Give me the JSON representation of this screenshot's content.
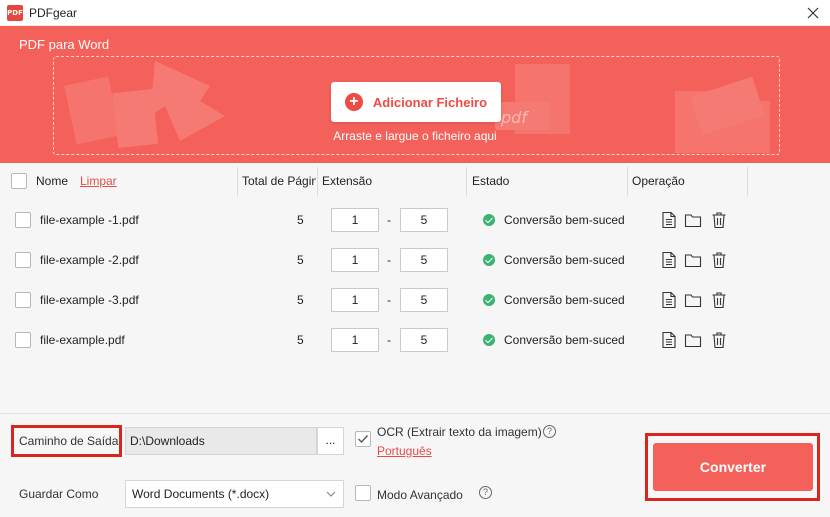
{
  "window": {
    "title": "PDFgear",
    "logo_text": "PDF"
  },
  "hero": {
    "title": "PDF para Word",
    "add_button_label": "Adicionar Ficheiro",
    "drop_hint": "Arraste e largue o ficheiro aqui",
    "deco_text": "pdf"
  },
  "table": {
    "headers": {
      "name": "Nome",
      "clear": "Limpar",
      "pages": "Total de Páginas",
      "range": "Extensão",
      "status": "Estado",
      "operation": "Operação"
    },
    "rows": [
      {
        "name": "file-example -1.pdf",
        "pages": "5",
        "from": "1",
        "to": "5",
        "status": "Conversão bem-sucedida"
      },
      {
        "name": "file-example -2.pdf",
        "pages": "5",
        "from": "1",
        "to": "5",
        "status": "Conversão bem-sucedida"
      },
      {
        "name": "file-example -3.pdf",
        "pages": "5",
        "from": "1",
        "to": "5",
        "status": "Conversão bem-sucedida"
      },
      {
        "name": "file-example.pdf",
        "pages": "5",
        "from": "1",
        "to": "5",
        "status": "Conversão bem-sucedida"
      }
    ],
    "range_separator": "-"
  },
  "bottom": {
    "output_path_label": "Caminho de Saída",
    "output_path_value": "D:\\Downloads",
    "browse_label": "...",
    "ocr_label": "OCR (Extrair texto da imagem)",
    "ocr_language": "Português",
    "ocr_checked": true,
    "save_as_label": "Guardar Como",
    "save_as_value": "Word Documents (*.docx)",
    "advanced_mode_label": "Modo Avançado",
    "advanced_mode_checked": false,
    "convert_label": "Converter",
    "help_glyph": "?"
  },
  "colors": {
    "accent": "#f4605a",
    "link": "#e24e47",
    "success": "#3cb371",
    "highlight": "#d9251e"
  }
}
